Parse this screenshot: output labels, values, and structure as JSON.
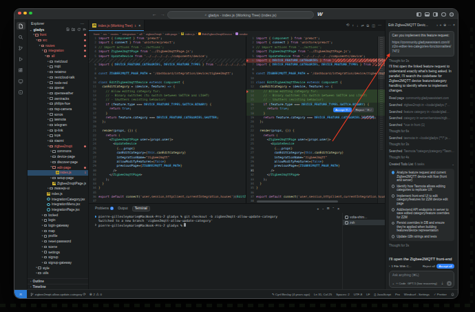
{
  "window": {
    "title_pill": "gladys - index.js (Working Tree) (index.js)",
    "logo": "W"
  },
  "sidebar": {
    "title": "Explorer",
    "section": "gladys",
    "tree": [
      {
        "l": "front",
        "lv": 1,
        "t": "folder",
        "e": 1,
        "red": 1,
        "dot": 1
      },
      {
        "l": "src",
        "lv": 2,
        "t": "folder",
        "e": 1,
        "red": 1,
        "dot": 1
      },
      {
        "l": "routes",
        "lv": 3,
        "t": "folder",
        "e": 1,
        "red": 1,
        "dot": 1
      },
      {
        "l": "integration",
        "lv": 4,
        "t": "folder",
        "e": 1,
        "red": 1,
        "dot": 1
      },
      {
        "l": "all",
        "lv": 5,
        "t": "folder",
        "e": 1,
        "red": 1,
        "dot": 1
      },
      {
        "l": "melcloud",
        "lv": 6,
        "t": "folder"
      },
      {
        "l": "mqtt",
        "lv": 6,
        "t": "folder"
      },
      {
        "l": "netatmo",
        "lv": 6,
        "t": "folder"
      },
      {
        "l": "nextcloud-talk",
        "lv": 6,
        "t": "folder"
      },
      {
        "l": "node-red",
        "lv": 6,
        "t": "folder"
      },
      {
        "l": "openai",
        "lv": 6,
        "t": "folder"
      },
      {
        "l": "openweather",
        "lv": 6,
        "t": "folder"
      },
      {
        "l": "owntracks",
        "lv": 6,
        "t": "folder"
      },
      {
        "l": "philips-hue",
        "lv": 6,
        "t": "folder"
      },
      {
        "l": "rtsp-camera",
        "lv": 6,
        "t": "folder"
      },
      {
        "l": "sonos",
        "lv": 6,
        "t": "folder"
      },
      {
        "l": "tasmota",
        "lv": 6,
        "t": "folder"
      },
      {
        "l": "telegram",
        "lv": 6,
        "t": "folder"
      },
      {
        "l": "tp-link",
        "lv": 6,
        "t": "folder"
      },
      {
        "l": "tuya",
        "lv": 6,
        "t": "folder"
      },
      {
        "l": "xiaomi",
        "lv": 6,
        "t": "folder"
      },
      {
        "l": "zigbee2mqtt",
        "lv": 6,
        "t": "folder",
        "e": 1,
        "red": 1,
        "dot": 1
      },
      {
        "l": "commons",
        "lv": 7,
        "t": "folder"
      },
      {
        "l": "device-page",
        "lv": 7,
        "t": "folder"
      },
      {
        "l": "discover-page",
        "lv": 7,
        "t": "folder"
      },
      {
        "l": "edit-page",
        "lv": 7,
        "t": "folder",
        "e": 1,
        "red": 1,
        "dot": 1
      },
      {
        "l": "index.js",
        "lv": 8,
        "t": "file",
        "icon": "js",
        "red": 1,
        "badge": "1",
        "sel": 1
      },
      {
        "l": "setup-page",
        "lv": 7,
        "t": "folder"
      },
      {
        "l": "Zigbee2mqttPage.js",
        "lv": 7,
        "t": "file",
        "icon": "js"
      },
      {
        "l": "zwavejs-ui",
        "lv": 6,
        "t": "folder"
      },
      {
        "l": "index.js",
        "lv": 5,
        "t": "file",
        "icon": "js"
      },
      {
        "l": "IntegrationCategory.jsx",
        "lv": 5,
        "t": "file",
        "icon": "react"
      },
      {
        "l": "IntegrationMenu.jsx",
        "lv": 5,
        "t": "file",
        "icon": "react"
      },
      {
        "l": "IntegrationPage.jsx",
        "lv": 5,
        "t": "file",
        "icon": "react"
      },
      {
        "l": "locked",
        "lv": 4,
        "t": "folder"
      },
      {
        "l": "login",
        "lv": 4,
        "t": "folder"
      },
      {
        "l": "login-gateway",
        "lv": 4,
        "t": "folder"
      },
      {
        "l": "map",
        "lv": 4,
        "t": "folder"
      },
      {
        "l": "profile",
        "lv": 4,
        "t": "folder"
      },
      {
        "l": "reset-password",
        "lv": 4,
        "t": "folder"
      },
      {
        "l": "scene",
        "lv": 4,
        "t": "folder"
      },
      {
        "l": "settings",
        "lv": 4,
        "t": "folder"
      },
      {
        "l": "signup",
        "lv": 4,
        "t": "folder"
      },
      {
        "l": "signup-gateway",
        "lv": 4,
        "t": "folder"
      },
      {
        "l": "style",
        "lv": 2,
        "t": "folder"
      },
      {
        "l": "utils",
        "lv": 2,
        "t": "folder"
      }
    ],
    "outline": "Outline",
    "timeline": "Timeline"
  },
  "tab": {
    "label": "index.js (Working Tree)",
    "badge": "1"
  },
  "breadcrumb": [
    "front",
    "src",
    "routes",
    "integration",
    "all",
    "zigbee2mqtt",
    "edit-page",
    "index.js",
    "EditZigbee2mqttDevice",
    "render"
  ],
  "editor": {
    "lines": [
      [
        [
          "k",
          "import "
        ],
        [
          "g",
          "{ "
        ],
        [
          "t",
          "Component"
        ],
        [
          "g",
          " }"
        ],
        [
          "k",
          " from "
        ],
        [
          "s",
          "'preact'"
        ],
        [
          "p",
          ";"
        ]
      ],
      [
        [
          "k",
          "import "
        ],
        [
          "g",
          "{ "
        ],
        [
          "v",
          "connect"
        ],
        [
          "g",
          " }"
        ],
        [
          "k",
          " from "
        ],
        [
          "s",
          "'unistore/preact'"
        ],
        [
          "p",
          ";"
        ]
      ],
      [
        [
          "c",
          "// import actions from '../actions';"
        ]
      ],
      [
        [
          "k",
          "import "
        ],
        [
          "t",
          "Zigbee2mqttPage"
        ],
        [
          "k",
          " from "
        ],
        [
          "s",
          "'../Zigbee2mqttPage.js'"
        ],
        [
          "p",
          ";"
        ]
      ],
      [
        [
          "k",
          "import "
        ],
        [
          "t",
          "UpdateDevice"
        ],
        [
          "k",
          " from "
        ],
        [
          "s",
          "'../../../../../components/device'"
        ],
        [
          "p",
          ";"
        ]
      ],
      [
        [
          "k",
          "import "
        ],
        [
          "g",
          "{ "
        ],
        [
          "n",
          "DEVICE_FEATURE_CATEGORIES"
        ],
        [
          "p",
          ", "
        ],
        [
          "n",
          "DEVICE_FEATURE_TYPES"
        ],
        [
          "g",
          " }"
        ],
        [
          "k",
          " from "
        ],
        [
          "s",
          "'../../../../../server/utils/constants'"
        ],
        [
          "p",
          ";"
        ]
      ],
      [],
      [
        [
          "b",
          "const "
        ],
        [
          "n",
          "ZIGBEE2MQTT_PAGE_PATH"
        ],
        [
          "p",
          " = "
        ],
        [
          "s",
          "'/dashboard/integration/device/zigbee2mqtt'"
        ],
        [
          "p",
          ";"
        ]
      ],
      [],
      [
        [
          "b",
          "class "
        ],
        [
          "t",
          "EditZigbee2mqttDevice"
        ],
        [
          "b",
          " extends "
        ],
        [
          "t",
          "Component"
        ],
        [
          "g",
          " {"
        ]
      ],
      [
        [
          "p",
          "  "
        ],
        [
          "f",
          "canEditCategory"
        ],
        [
          "p",
          " = ("
        ],
        [
          "v",
          "device"
        ],
        [
          "p",
          ", "
        ],
        [
          "v",
          "feature"
        ],
        [
          "p",
          ") "
        ],
        [
          "b",
          "=>"
        ],
        [
          "g",
          " {"
        ]
      ],
      [
        [
          "c",
          "    // Allow editing category for:"
        ]
      ],
      [
        [
          "c",
          "    // - Binary switches (to switch between SWITCH and LIGHT)"
        ]
      ],
      [
        [
          "c",
          "    // - Shutters (existing behavior)"
        ]
      ],
      [
        [
          "p",
          "    "
        ],
        [
          "k",
          "if "
        ],
        [
          "p",
          "("
        ],
        [
          "v",
          "feature"
        ],
        [
          "p",
          "."
        ],
        [
          "v",
          "type"
        ],
        [
          "p",
          " === "
        ],
        [
          "n",
          "DEVICE_FEATURE_TYPES"
        ],
        [
          "p",
          "."
        ],
        [
          "n",
          "SWITCH"
        ],
        [
          "p",
          "."
        ],
        [
          "n",
          "BINARY"
        ],
        [
          "p",
          ") "
        ],
        [
          "g",
          "{"
        ]
      ],
      [
        [
          "p",
          "      "
        ],
        [
          "k",
          "return "
        ],
        [
          "b",
          "true"
        ],
        [
          "p",
          ";"
        ]
      ],
      [
        [
          "g",
          "    }"
        ]
      ],
      [
        [
          "p",
          "    "
        ],
        [
          "k",
          "return "
        ],
        [
          "v",
          "feature"
        ],
        [
          "p",
          "."
        ],
        [
          "v",
          "category"
        ],
        [
          "p",
          " === "
        ],
        [
          "n",
          "DEVICE_FEATURE_CATEGORIES"
        ],
        [
          "p",
          "."
        ],
        [
          "n",
          "SHUTTER"
        ],
        [
          "p",
          ";"
        ]
      ],
      [
        [
          "g",
          "  }"
        ],
        [
          "p",
          ";"
        ]
      ],
      [],
      [
        [
          "p",
          "  "
        ],
        [
          "f",
          "render"
        ],
        [
          "p",
          "("
        ],
        [
          "v",
          "props"
        ],
        [
          "p",
          ", "
        ],
        [
          "g",
          "{}"
        ],
        [
          "p",
          ") "
        ],
        [
          "g",
          "{"
        ]
      ],
      [
        [
          "p",
          "    "
        ],
        [
          "k",
          "return "
        ],
        [
          "g",
          "("
        ]
      ],
      [
        [
          "p",
          "      <"
        ],
        [
          "t",
          "Zigbee2mqttPage"
        ],
        [
          "v",
          " user"
        ],
        [
          "p",
          "="
        ],
        [
          "g",
          "{"
        ],
        [
          "v",
          "props"
        ],
        [
          "p",
          "."
        ],
        [
          "v",
          "user"
        ],
        [
          "g",
          "}"
        ],
        [
          "p",
          ">"
        ]
      ],
      [
        [
          "p",
          "        <"
        ],
        [
          "t",
          "UpdateDevice"
        ]
      ],
      [
        [
          "p",
          "          "
        ],
        [
          "g",
          "{"
        ],
        [
          "p",
          "..."
        ],
        [
          "v",
          "props"
        ],
        [
          "g",
          "}"
        ]
      ],
      [
        [
          "p",
          "          "
        ],
        [
          "v",
          "canEditCategory"
        ],
        [
          "p",
          "="
        ],
        [
          "g",
          "{"
        ],
        [
          "b",
          "this"
        ],
        [
          "p",
          "."
        ],
        [
          "f",
          "canEditCategory"
        ],
        [
          "g",
          "}"
        ]
      ],
      [
        [
          "p",
          "          "
        ],
        [
          "v",
          "integrationName"
        ],
        [
          "p",
          "="
        ],
        [
          "s",
          "\"zigbee2mqtt\""
        ]
      ],
      [
        [
          "p",
          "          "
        ],
        [
          "v",
          "allowModifyFeatures"
        ],
        [
          "p",
          "="
        ],
        [
          "g",
          "{"
        ],
        [
          "b",
          "false"
        ],
        [
          "g",
          "}"
        ]
      ],
      [
        [
          "p",
          "          "
        ],
        [
          "v",
          "previousPage"
        ],
        [
          "p",
          "="
        ],
        [
          "g",
          "{"
        ],
        [
          "n",
          "ZIGBEE2MQTT_PAGE_PATH"
        ],
        [
          "g",
          "}"
        ]
      ],
      [
        [
          "p",
          "        />"
        ]
      ],
      [
        [
          "p",
          "      </"
        ],
        [
          "t",
          "Zigbee2mqttPage"
        ],
        [
          "p",
          ">"
        ]
      ],
      [
        [
          "p",
          "    );"
        ]
      ],
      [
        [
          "g",
          "  }"
        ]
      ],
      [
        [
          "g",
          "}"
        ]
      ],
      [],
      [
        [
          "k",
          "export default "
        ],
        [
          "f",
          "connect"
        ],
        [
          "p",
          "("
        ],
        [
          "s",
          "'user,session,httpClient,currentIntegration,houses'"
        ],
        [
          "p",
          ")("
        ],
        [
          "t",
          "EditZigbee2mqttDevice"
        ],
        [
          "p",
          ");"
        ]
      ],
      []
    ],
    "red_line": [
      [
        "k",
        "import "
      ],
      [
        "g",
        "{ "
      ],
      [
        "n",
        "DEVICE_FEATURE_CATEGORIES"
      ],
      [
        "g",
        " }"
      ],
      [
        "k",
        " from "
      ],
      [
        "x",
        "'../../../../../../server/utils/constants'"
      ],
      [
        "p",
        ";"
      ]
    ],
    "word_change": "SHUTTER"
  },
  "diff_buttons": {
    "accept": "Accept",
    "accept_kbd": "⌘⏎",
    "reject": "Reject",
    "reject_kbd": "⌃⌘⏎"
  },
  "terminal": {
    "tabs": {
      "problems": "Problems",
      "problems_badge": "2",
      "output": "Output",
      "terminal": "Terminal"
    },
    "rows": [
      {
        "mark": "blue",
        "text": "pierre-gillesleymarie@MacBook-Pro-2 gladys % git checkout -b zigbee2mqtt-allow-update-category"
      },
      {
        "mark": "",
        "text": "Switched to a new branch 'zigbee2mqtt-allow-update-category'"
      },
      {
        "mark": "ring",
        "text": "pierre-gillesleymarie@MacBook-Pro-2 gladys % ",
        "cursor": true
      }
    ],
    "list": [
      {
        "label": "volta-shim…",
        "sel": false
      },
      {
        "label": "zsh",
        "sel": true
      }
    ]
  },
  "cascade": {
    "title": "Edit Zigbee2MQTT Devic...",
    "user_message": "Can you implement this feature request:",
    "user_link": "https://community.gladysassistant.com/t/z2m-editer-les-categories-fonctionnalites/7472",
    "steps": [
      {
        "t": "thought",
        "x": "Thought for 3s"
      },
      {
        "t": "para",
        "x": "I'll first open the linked feature request to understand exactly what's being asked. In parallel, I'll search the codebase for Zigbee2MQTT device feature/category handling to identify where to implement changes."
      },
      {
        "t": "act",
        "l": "Read page",
        "d": "community.gladysassistant.com"
      },
      {
        "t": "act",
        "l": "Searched",
        "d": "zigbee2mqtt in ~/code/gladys (*…"
      },
      {
        "t": "act",
        "l": "Searched",
        "d": "feature category in ~/code/glad…"
      },
      {
        "t": "act",
        "l": "Searched",
        "d": "category in server/services/zigb…"
      },
      {
        "t": "act",
        "l": "Searched",
        "d": "*vue in front (1)"
      },
      {
        "t": "thought",
        "x": "Thought for 6s"
      },
      {
        "t": "act",
        "l": "Searched",
        "d": "tasmota in ~/code/gladys (**/*.js…"
      },
      {
        "t": "thought",
        "x": "Thought for 3s"
      },
      {
        "t": "act",
        "l": "Searched",
        "d": "Tasmota.*category|category.*Tasm…"
      },
      {
        "t": "thought",
        "x": "Thought for 4s"
      },
      {
        "t": "todo_header",
        "l": "Created Todo List",
        "d": "6 tasks"
      }
    ],
    "todo": [
      {
        "state": "active",
        "text": "Analyze feature request and current Zigbee2MQTT device edit flow (front and server)"
      },
      {
        "state": "open",
        "text": "Identify how Tasmota allows editing categories to replicate UX"
      },
      {
        "state": "open",
        "text": "Implement front-end UI to edit category/features for Z2M device edit page"
      },
      {
        "state": "open",
        "text": "Add/extend API endpoints in server to save edited category/feature overrides for Z2M"
      },
      {
        "state": "open",
        "text": "Persist overrides in DB and ensure they're applied when building features/device representation"
      },
      {
        "state": "open",
        "text": "Update i18n strings and tests"
      }
    ],
    "closing_thought": "Thought for 3s",
    "followup": "I'll open the Zigbee2MQTT front-end",
    "files_bar": {
      "expander": "1 File With C...",
      "reject": "Reject all",
      "accept": "Accept all"
    },
    "input": {
      "placeholder": "Ask anything (⌘L)",
      "mode": "Code",
      "model": "GPT-5 (low reasoning)"
    }
  },
  "status_bar": {
    "branch": "zigbee2mqtt-allow-update-category",
    "errors": "2",
    "warnings": "0",
    "right": [
      "Cyril Beslay (4 years ago)",
      "Ln 31, Col 25",
      "Spaces: 2",
      "UTF-8",
      "LF",
      "JavaScript",
      "Pro",
      "Windsurf - Settings",
      "Prettier"
    ]
  },
  "colors": {
    "accent_blue": "#2f81f7",
    "error_red": "#e0706a",
    "traffic": [
      "#ff5f57",
      "#febc2e",
      "#28c840"
    ]
  }
}
